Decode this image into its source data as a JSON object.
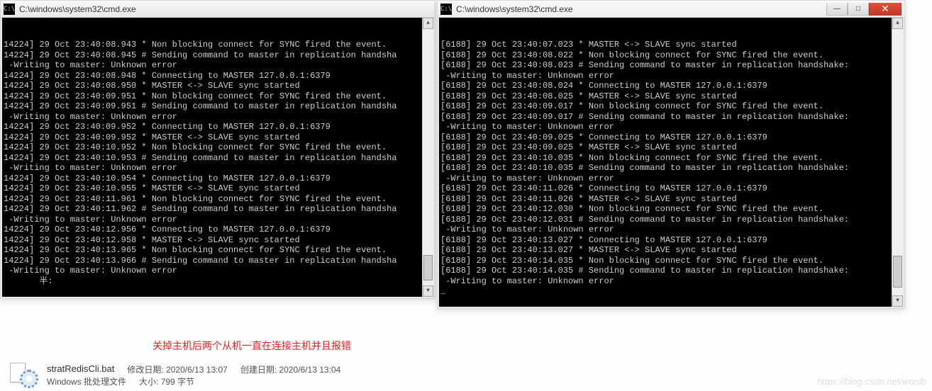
{
  "left_window": {
    "title": "C:\\windows\\system32\\cmd.exe",
    "lines": [
      "14224] 29 Oct 23:40:08.943 * Non blocking connect for SYNC fired the event.",
      "14224] 29 Oct 23:40:08.945 # Sending command to master in replication handsha",
      " -Writing to master: Unknown error",
      "14224] 29 Oct 23:40:08.948 * Connecting to MASTER 127.0.0.1:6379",
      "14224] 29 Oct 23:40:08.950 * MASTER <-> SLAVE sync started",
      "14224] 29 Oct 23:40:09.951 * Non blocking connect for SYNC fired the event.",
      "14224] 29 Oct 23:40:09.951 # Sending command to master in replication handsha",
      " -Writing to master: Unknown error",
      "14224] 29 Oct 23:40:09.952 * Connecting to MASTER 127.0.0.1:6379",
      "14224] 29 Oct 23:40:09.952 * MASTER <-> SLAVE sync started",
      "14224] 29 Oct 23:40:10.952 * Non blocking connect for SYNC fired the event.",
      "14224] 29 Oct 23:40:10.953 # Sending command to master in replication handsha",
      " -Writing to master: Unknown error",
      "14224] 29 Oct 23:40:10.954 * Connecting to MASTER 127.0.0.1:6379",
      "14224] 29 Oct 23:40:10.955 * MASTER <-> SLAVE sync started",
      "14224] 29 Oct 23:40:11.961 * Non blocking connect for SYNC fired the event.",
      "14224] 29 Oct 23:40:11.962 # Sending command to master in replication handsha",
      " -Writing to master: Unknown error",
      "14224] 29 Oct 23:40:12.956 * Connecting to MASTER 127.0.0.1:6379",
      "14224] 29 Oct 23:40:12.958 * MASTER <-> SLAVE sync started",
      "14224] 29 Oct 23:40:13.965 * Non blocking connect for SYNC fired the event.",
      "14224] 29 Oct 23:40:13.966 # Sending command to master in replication handsha",
      " -Writing to master: Unknown error",
      "",
      "       半:"
    ]
  },
  "right_window": {
    "title": "C:\\windows\\system32\\cmd.exe",
    "lines": [
      "[6188] 29 Oct 23:40:07.023 * MASTER <-> SLAVE sync started",
      "[6188] 29 Oct 23:40:08.022 * Non blocking connect for SYNC fired the event.",
      "[6188] 29 Oct 23:40:08.023 # Sending command to master in replication handshake:",
      " -Writing to master: Unknown error",
      "[6188] 29 Oct 23:40:08.024 * Connecting to MASTER 127.0.0.1:6379",
      "[6188] 29 Oct 23:40:08.025 * MASTER <-> SLAVE sync started",
      "[6188] 29 Oct 23:40:09.017 * Non blocking connect for SYNC fired the event.",
      "[6188] 29 Oct 23:40:09.017 # Sending command to master in replication handshake:",
      " -Writing to master: Unknown error",
      "[6188] 29 Oct 23:40:09.025 * Connecting to MASTER 127.0.0.1:6379",
      "[6188] 29 Oct 23:40:09.025 * MASTER <-> SLAVE sync started",
      "[6188] 29 Oct 23:40:10.035 * Non blocking connect for SYNC fired the event.",
      "[6188] 29 Oct 23:40:10.035 # Sending command to master in replication handshake:",
      " -Writing to master: Unknown error",
      "[6188] 29 Oct 23:40:11.026 * Connecting to MASTER 127.0.0.1:6379",
      "[6188] 29 Oct 23:40:11.026 * MASTER <-> SLAVE sync started",
      "[6188] 29 Oct 23:40:12.030 * Non blocking connect for SYNC fired the event.",
      "[6188] 29 Oct 23:40:12.031 # Sending command to master in replication handshake:",
      " -Writing to master: Unknown error",
      "[6188] 29 Oct 23:40:13.027 * Connecting to MASTER 127.0.0.1:6379",
      "[6188] 29 Oct 23:40:13.027 * MASTER <-> SLAVE sync started",
      "[6188] 29 Oct 23:40:14.035 * Non blocking connect for SYNC fired the event.",
      "[6188] 29 Oct 23:40:14.035 # Sending command to master in replication handshake:",
      " -Writing to master: Unknown error",
      "_"
    ]
  },
  "annotation": "关掉主机后两个从机一直在连接主机并且报错",
  "file": {
    "name": "stratRedisCli.bat",
    "modify_label": "修改日期:",
    "modify_value": "2020/6/13 13:07",
    "create_label": "创建日期:",
    "create_value": "2020/6/13 13:04",
    "type": "Windows 批处理文件",
    "size_label": "大小:",
    "size_value": "799 字节"
  },
  "watermark": "https://blog.csdn.net/wonlb",
  "win_buttons": {
    "min": "—",
    "max": "□",
    "close": "✕"
  },
  "icon_glyph": "C:\\"
}
